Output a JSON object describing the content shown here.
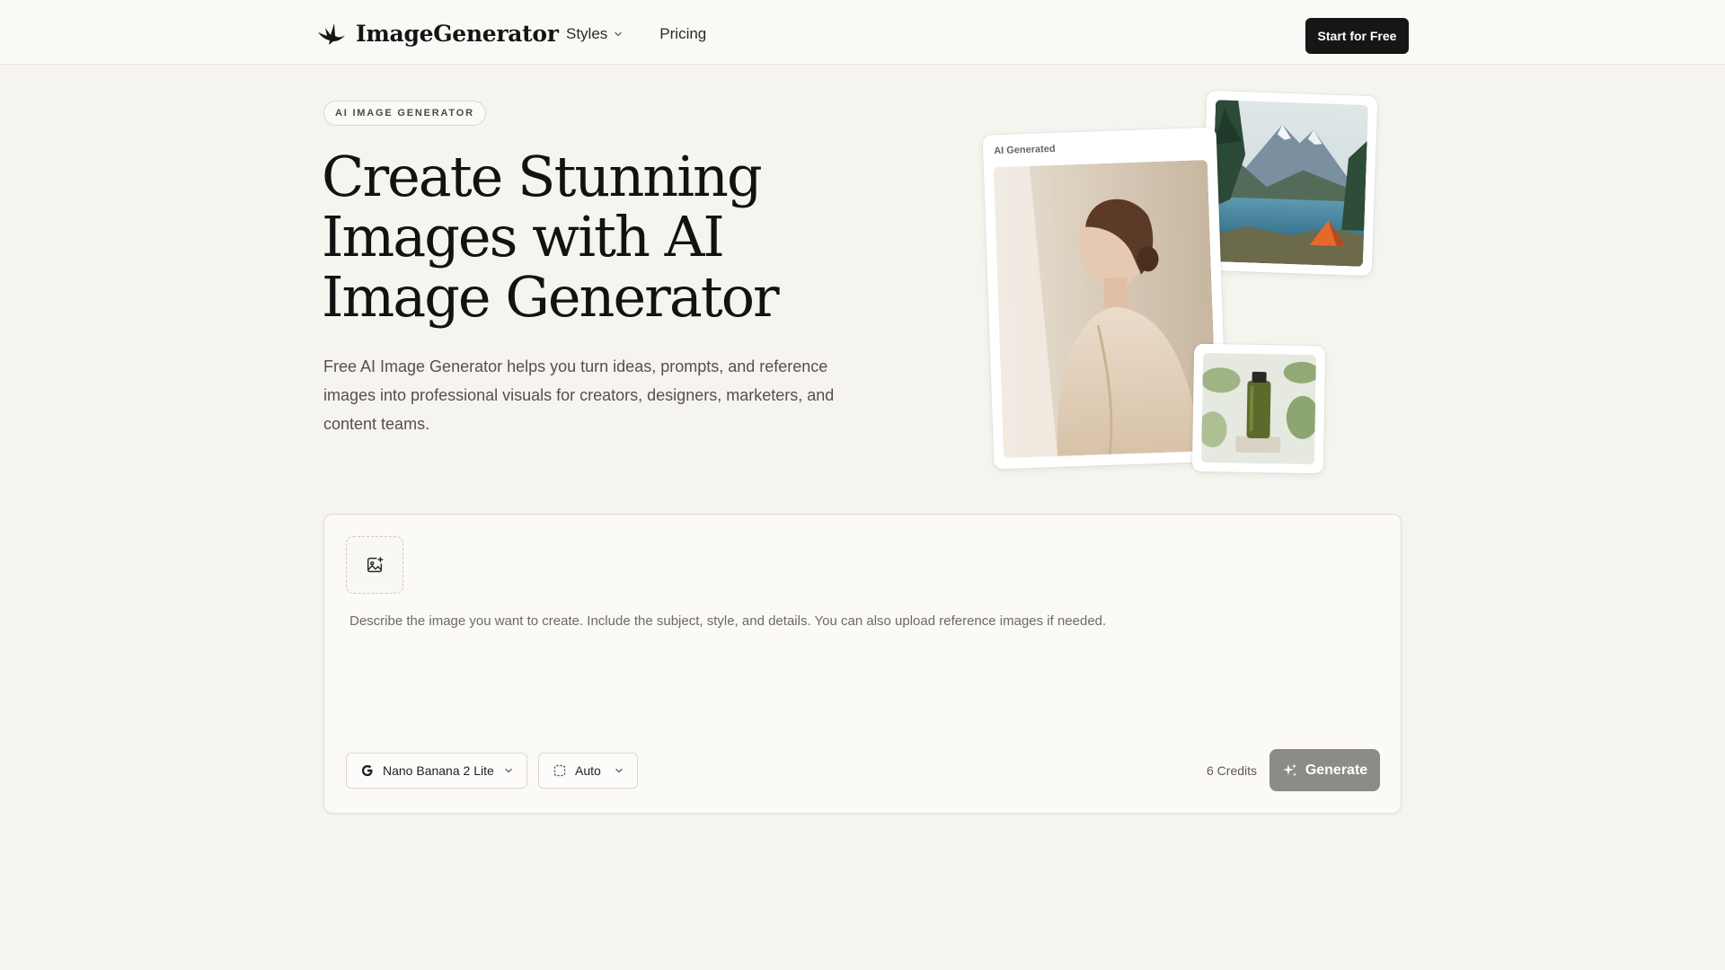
{
  "header": {
    "logo_text": "ImageGenerator",
    "nav": [
      {
        "label": "Styles"
      },
      {
        "label": "Pricing"
      }
    ],
    "cta_label": "Start for Free"
  },
  "hero": {
    "badge": "AI IMAGE GENERATOR",
    "title": "Create Stunning Images with AI Image Generator",
    "subtitle": "Free AI Image Generator helps you turn ideas, prompts, and reference images into professional visuals for creators, designers, marketers, and content teams."
  },
  "collage": {
    "portrait_caption": "AI Generated"
  },
  "prompt": {
    "placeholder": "Describe the image you want to create. Include the subject, style, and details. You can also upload reference images if needed.",
    "model_label": "Nano Banana 2 Lite",
    "aspect_label": "Auto",
    "credits": "6 Credits",
    "generate_label": "Generate"
  },
  "colors": {
    "background": "#f6f4ef",
    "header_bg": "#faf9f6",
    "cta_bg": "#161616",
    "generate_bg": "#8d8b87"
  },
  "icons": {
    "logo": "bird-logo-icon",
    "styles_dropdown": "chevron-down-icon",
    "upload": "image-plus-icon",
    "model": "google-g-icon",
    "aspect": "dashed-square-icon",
    "generate": "sparkles-icon"
  }
}
